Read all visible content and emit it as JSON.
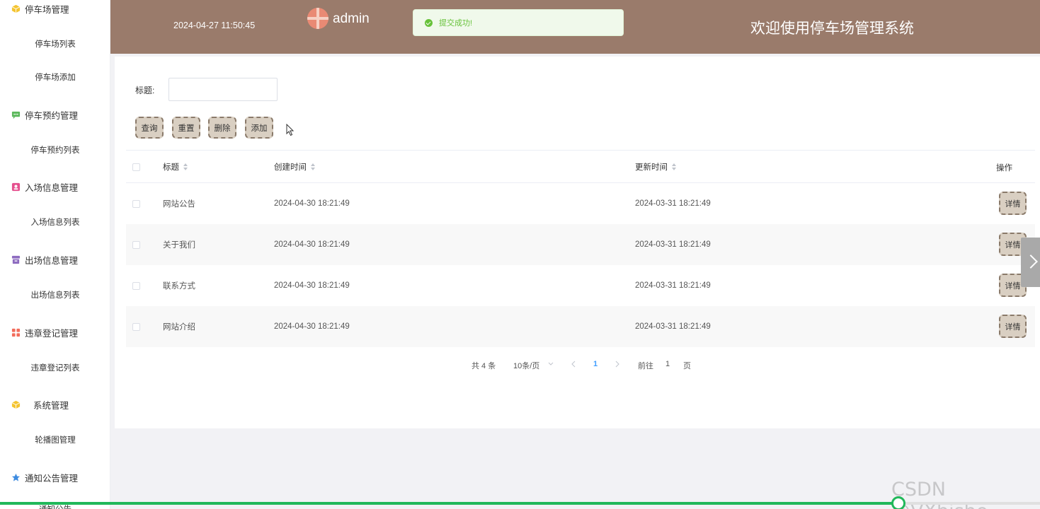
{
  "sidebar": {
    "groups": [
      {
        "label": "停车场管理",
        "icon": "cube-icon",
        "color": "#f4c430",
        "items": [
          "停车场列表",
          "停车场添加"
        ]
      },
      {
        "label": "停车预约管理",
        "icon": "chat-icon",
        "color": "#5cb85c",
        "items": [
          "停车预约列表"
        ]
      },
      {
        "label": "入场信息管理",
        "icon": "badge-icon",
        "color": "#e5508e",
        "items": [
          "入场信息列表"
        ]
      },
      {
        "label": "出场信息管理",
        "icon": "archive-icon",
        "color": "#8e6cc0",
        "items": [
          "出场信息列表"
        ]
      },
      {
        "label": "违章登记管理",
        "icon": "grid-icon",
        "color": "#f26d5b",
        "items": [
          "违章登记列表"
        ]
      },
      {
        "label": "系统管理",
        "icon": "cube-icon",
        "color": "#f4c430",
        "items": [
          "轮播图管理"
        ]
      },
      {
        "label": "通知公告管理",
        "icon": "star-icon",
        "color": "#3d8be0",
        "items": [
          "通知公告"
        ]
      }
    ]
  },
  "header": {
    "datetime": "2024-04-27 11:50:45",
    "username": "admin",
    "title": "欢迎使用停车场管理系统",
    "bg_color": "#9a7b6b"
  },
  "toast": {
    "message": "提交成功!",
    "type": "success"
  },
  "search": {
    "label": "标题:",
    "value": "",
    "placeholder": ""
  },
  "buttons": {
    "query": "查询",
    "reset": "重置",
    "delete": "删除",
    "add": "添加"
  },
  "table": {
    "columns": [
      "标题",
      "创建时间",
      "更新时间",
      "操作"
    ],
    "rows": [
      {
        "title": "网站公告",
        "created": "2024-04-30 18:21:49",
        "updated": "2024-03-31 18:21:49",
        "action": "详情"
      },
      {
        "title": "关于我们",
        "created": "2024-04-30 18:21:49",
        "updated": "2024-03-31 18:21:49",
        "action": "详情"
      },
      {
        "title": "联系方式",
        "created": "2024-04-30 18:21:49",
        "updated": "2024-03-31 18:21:49",
        "action": "详情"
      },
      {
        "title": "网站介绍",
        "created": "2024-04-30 18:21:49",
        "updated": "2024-03-31 18:21:49",
        "action": "详情"
      }
    ]
  },
  "pagination": {
    "total": "共 4 条",
    "page_size": "10条/页",
    "current_page": "1",
    "goto_label": "前往",
    "goto_value": "1",
    "goto_unit": "页"
  },
  "video": {
    "progress": 0.864
  },
  "watermark": "CSDN @VXbishe"
}
